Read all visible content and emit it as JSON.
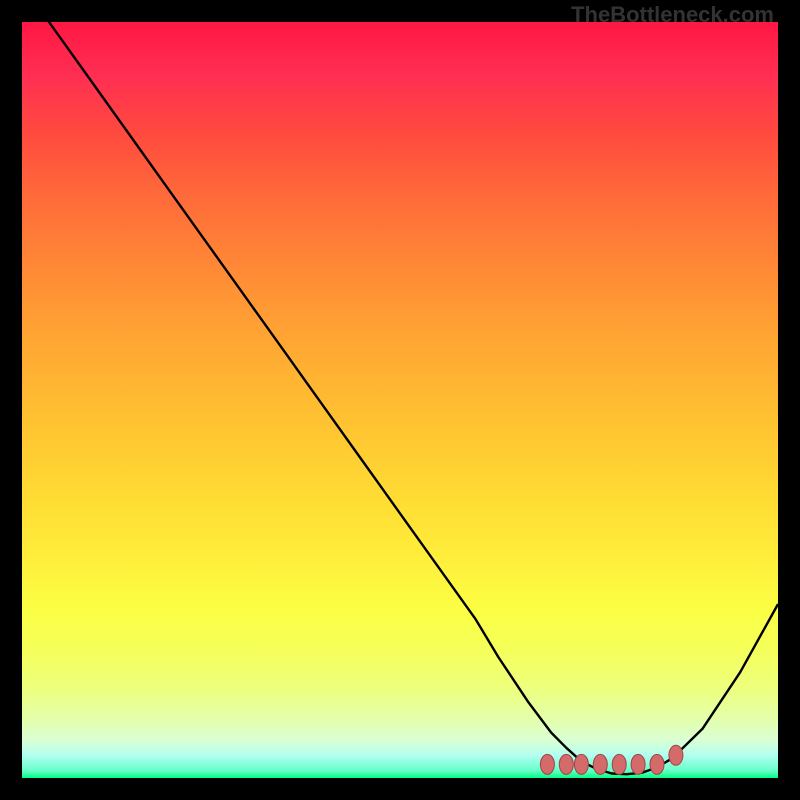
{
  "watermark": "TheBottleneck.com",
  "chart_data": {
    "type": "line",
    "title": "",
    "xlabel": "",
    "ylabel": "",
    "xlim": [
      0,
      100
    ],
    "ylim": [
      0,
      100
    ],
    "gradient_stops": [
      {
        "pos": 0,
        "color": "#ff1744"
      },
      {
        "pos": 15,
        "color": "#ff4b3e"
      },
      {
        "pos": 31,
        "color": "#ff8436"
      },
      {
        "pos": 47,
        "color": "#ffb332"
      },
      {
        "pos": 63,
        "color": "#ffdc33"
      },
      {
        "pos": 78,
        "color": "#fbff44"
      },
      {
        "pos": 88,
        "color": "#edff7c"
      },
      {
        "pos": 95,
        "color": "#daffd4"
      },
      {
        "pos": 100,
        "color": "#00ff7f"
      }
    ],
    "series": [
      {
        "name": "main-curve",
        "x": [
          0,
          5,
          10,
          15,
          20,
          25,
          30,
          35,
          40,
          45,
          50,
          55,
          60,
          63,
          67,
          70,
          72,
          74,
          76,
          78,
          80,
          82,
          84,
          86,
          90,
          95,
          100
        ],
        "y": [
          105,
          98,
          91,
          84,
          77,
          70,
          63,
          56,
          49,
          42,
          35,
          28,
          21,
          16,
          10,
          6,
          4,
          2.2,
          1.2,
          0.6,
          0.5,
          0.7,
          1.4,
          2.6,
          6.5,
          14,
          23
        ]
      },
      {
        "name": "marker-dots",
        "type": "scatter",
        "marker_color": "#d46a6a",
        "marker_border": "#a04545",
        "x": [
          69.5,
          72.0,
          74.0,
          76.5,
          79.0,
          81.5,
          84.0,
          86.5
        ],
        "y": [
          1.8,
          1.8,
          1.8,
          1.8,
          1.8,
          1.8,
          1.8,
          3.0
        ]
      }
    ]
  }
}
